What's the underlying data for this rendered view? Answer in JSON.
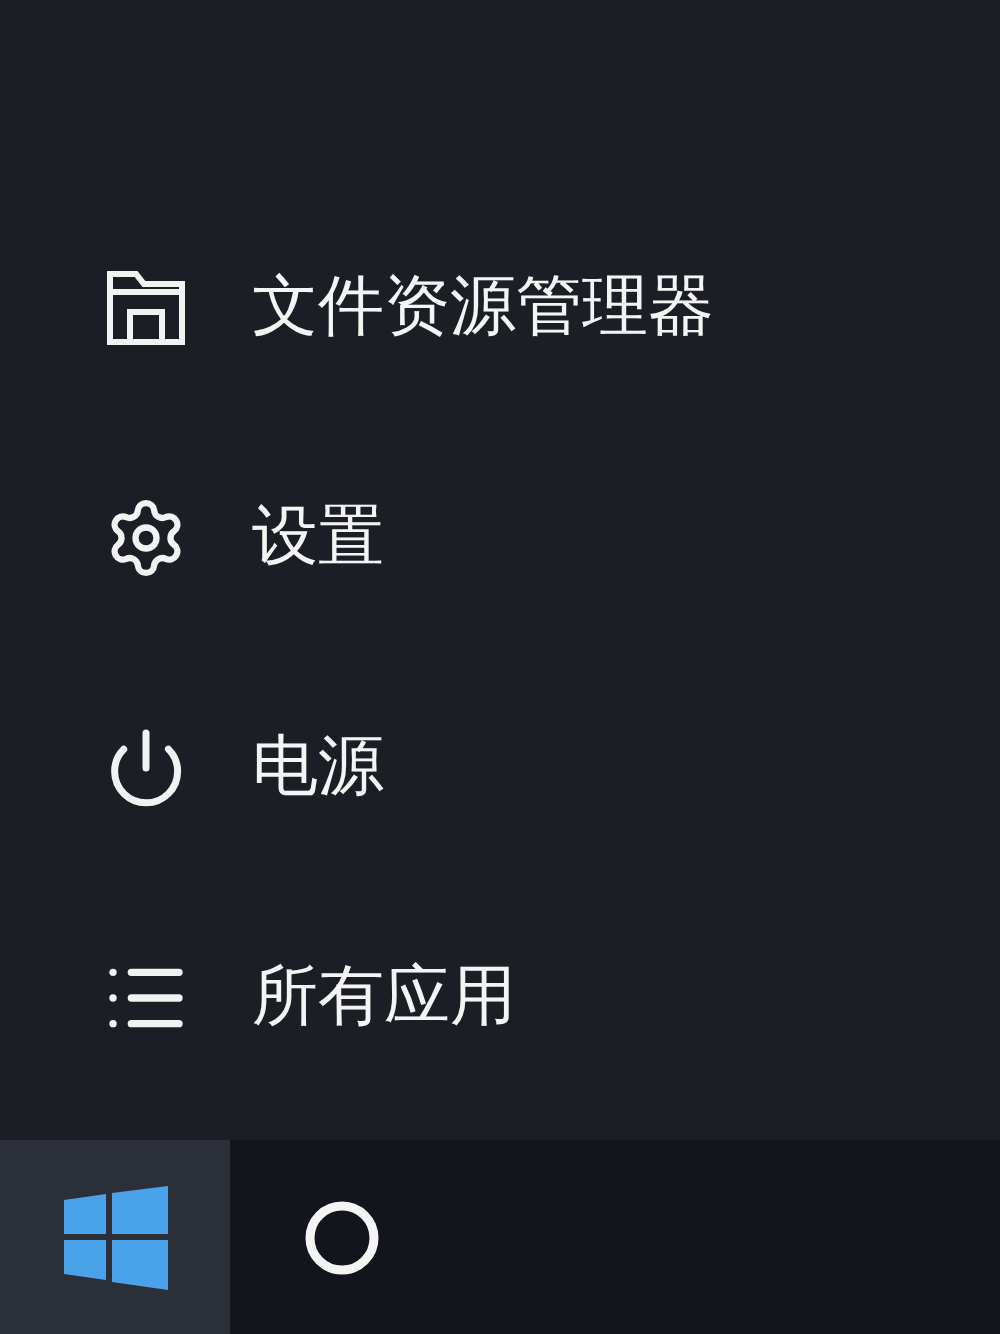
{
  "menu_items": [
    {
      "label": "文件资源管理器",
      "kind": "explorer"
    },
    {
      "label": "设置",
      "kind": "settings"
    },
    {
      "label": "电源",
      "kind": "power"
    },
    {
      "label": "所有应用",
      "kind": "apps"
    }
  ],
  "taskbar": [
    {
      "kind": "start",
      "selected": true
    },
    {
      "kind": "cortana",
      "selected": false
    }
  ]
}
